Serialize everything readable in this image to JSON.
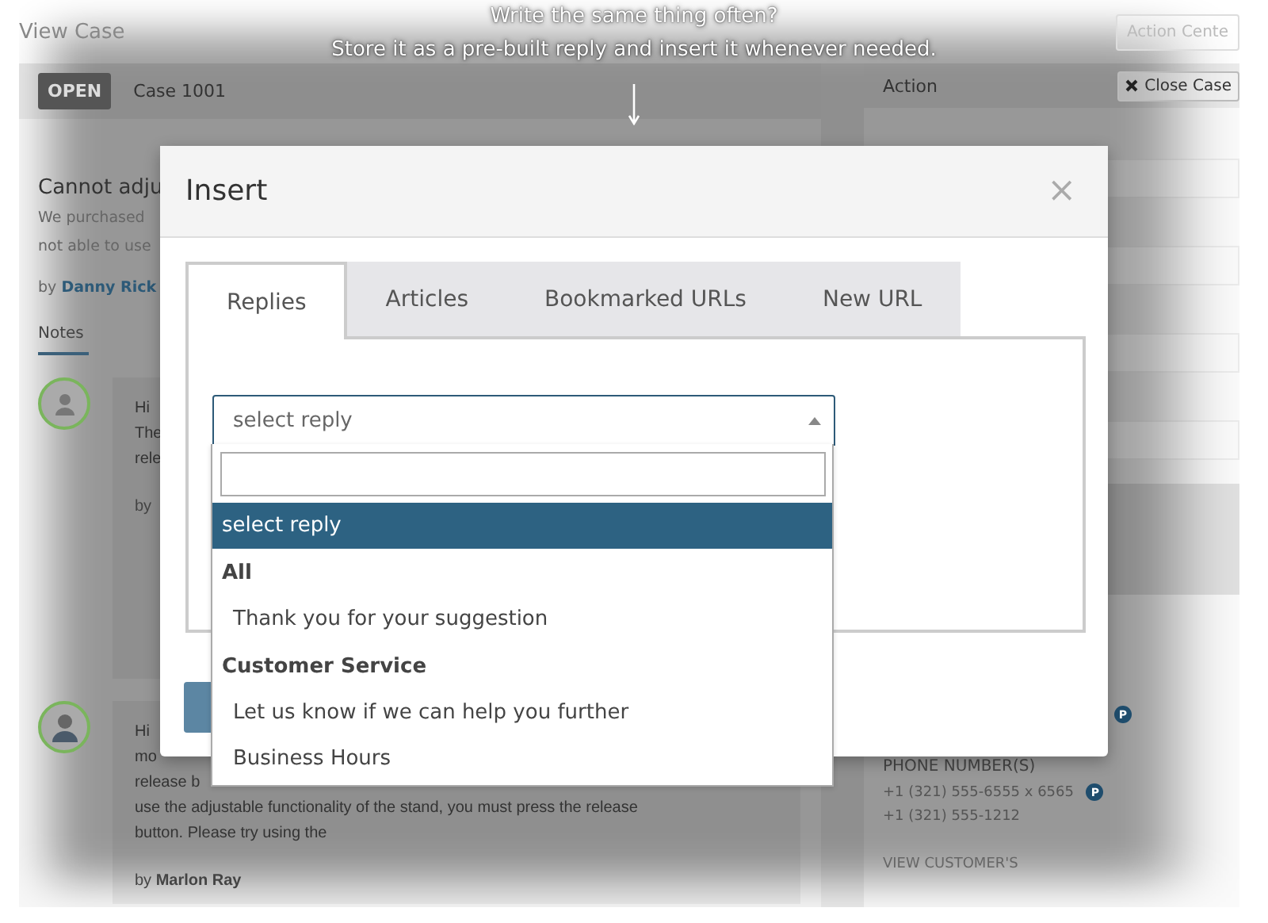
{
  "caption": {
    "lines": [
      "Write the same thing often?",
      "Store it as a pre-built reply and insert it whenever needed."
    ]
  },
  "background": {
    "page_title": "View Case",
    "action_center": "Action Cente",
    "case": {
      "status": "OPEN",
      "title": "Case 1001",
      "subject": "Cannot adju",
      "description_lines": [
        "We purchased",
        "not able to use"
      ],
      "by_prefix": "by",
      "author": "Danny Rick"
    },
    "notes_tab": "Notes",
    "notes": [
      {
        "kind": "placeholder",
        "lines": [
          "Hi",
          "The",
          "rele"
        ],
        "by_prefix": "by"
      },
      {
        "kind": "photo",
        "lines": [
          "Hi",
          "mo",
          "release b",
          "use the adjustable functionality of the stand, you must press the release",
          "button. Please try using the"
        ],
        "by_prefix": "by",
        "author": "Marlon Ray"
      }
    ],
    "action": {
      "title": "Action",
      "close_button": "Close Case",
      "extra_badge": "P",
      "phone_label": "PHONE NUMBER(S)",
      "phones": [
        {
          "text": "+1 (321) 555-6555 x 6565",
          "primary": true
        },
        {
          "text": "+1 (321) 555-1212",
          "primary": false
        }
      ],
      "primary_badge": "P",
      "view_link": "VIEW CUSTOMER'S"
    }
  },
  "modal": {
    "title": "Insert",
    "close": "×",
    "tabs": [
      {
        "label": "Replies",
        "selected": true
      },
      {
        "label": "Articles",
        "selected": false
      },
      {
        "label": "Bookmarked URLs",
        "selected": false
      },
      {
        "label": "New URL",
        "selected": false
      }
    ],
    "select": {
      "value": "select reply",
      "expanded": true
    },
    "options": [
      {
        "kind": "option",
        "label": "select reply",
        "selected": true
      },
      {
        "kind": "group",
        "label": "All"
      },
      {
        "kind": "option",
        "label": "Thank you for your suggestion",
        "selected": false
      },
      {
        "kind": "group",
        "label": "Customer Service"
      },
      {
        "kind": "option",
        "label": "Let us know if we can help you further",
        "selected": false
      },
      {
        "kind": "option",
        "label": "Business Hours",
        "selected": false
      }
    ]
  }
}
